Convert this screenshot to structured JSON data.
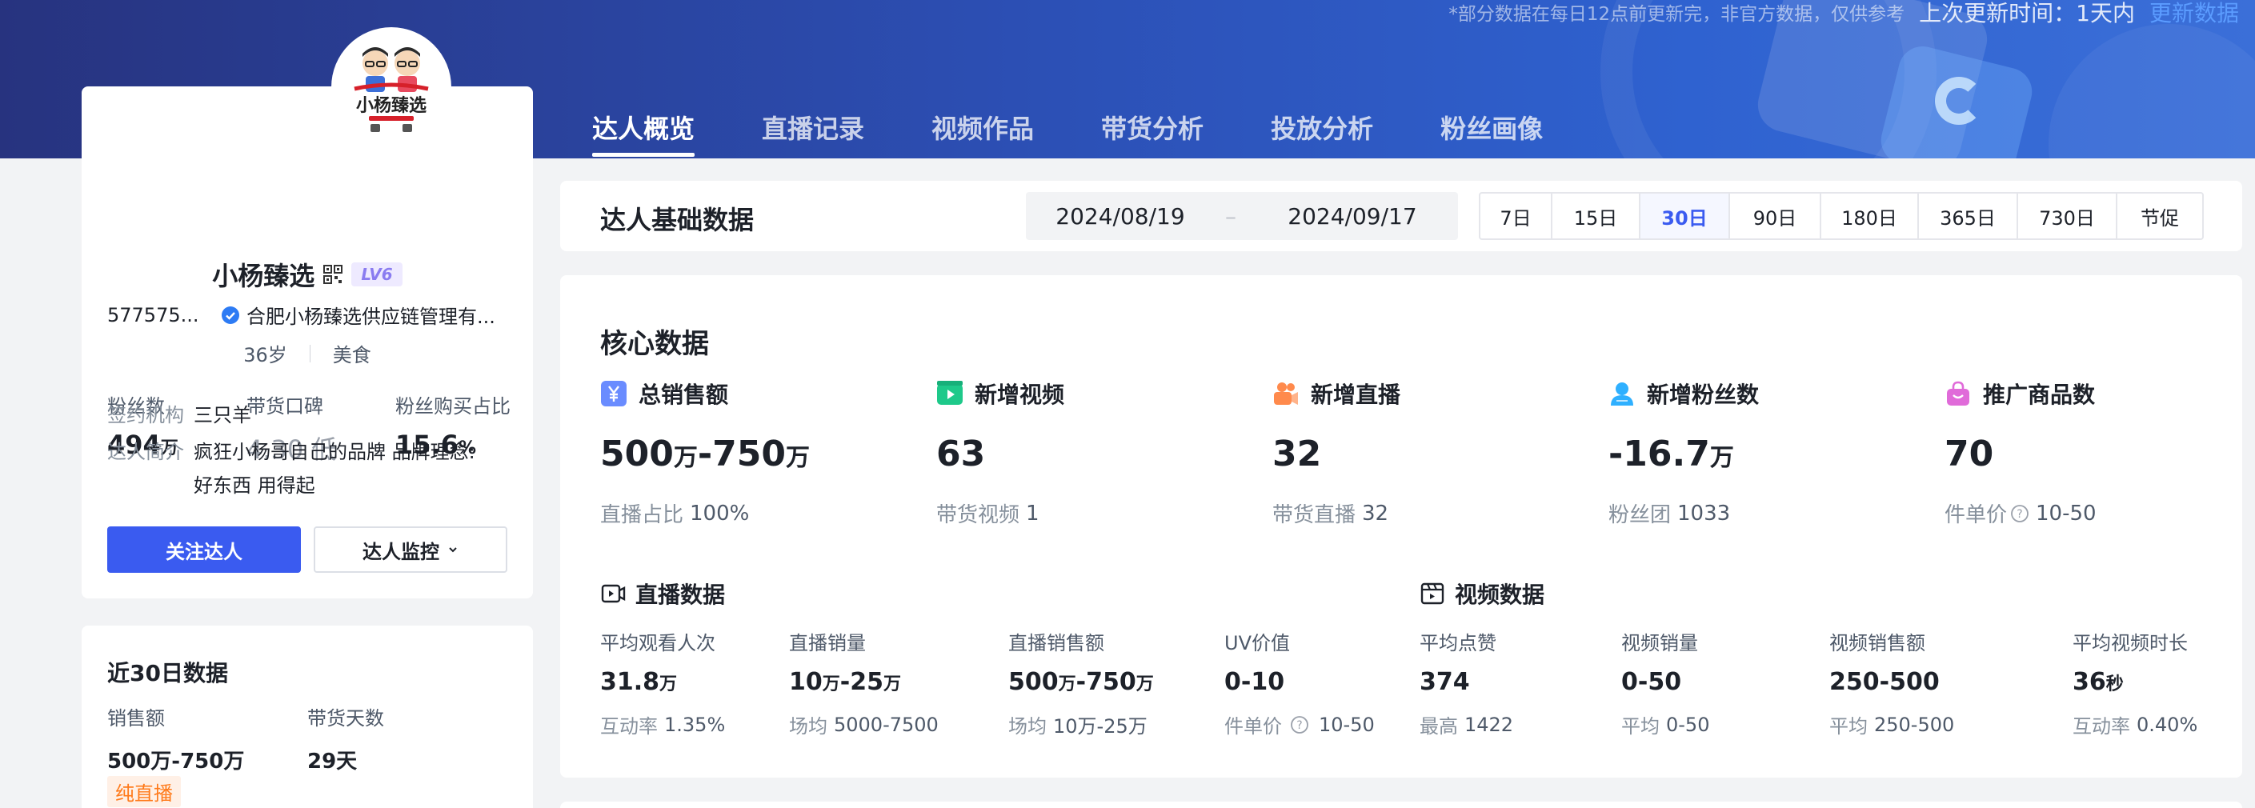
{
  "top_bar": {
    "note": "*部分数据在每日12点前更新完，非官方数据，仅供参考",
    "last_update_label": "上次更新时间：1天内",
    "update_link": "更新数据"
  },
  "profile": {
    "avatar_logo_text": "小杨臻选",
    "name": "小杨臻选",
    "level": "LV6",
    "uid": "577575...",
    "company": "合肥小杨臻选供应链管理有...",
    "age": "36岁",
    "category": "美食",
    "stats": [
      {
        "label": "粉丝数",
        "value": "494",
        "unit": "万"
      },
      {
        "label": "带货口碑",
        "value": "4.30 低"
      },
      {
        "label": "粉丝购买占比",
        "value": "15.6",
        "unit": "%"
      }
    ],
    "agency_label": "签约机构",
    "agency": "三只羊",
    "intro_label": "达人简介",
    "intro_line1": "疯狂小杨哥自己的品牌 品牌理念:",
    "intro_line2": "好东西 用得起",
    "follow_button": "关注达人",
    "monitor_button": "达人监控"
  },
  "recent30": {
    "title": "近30日数据",
    "sales_label": "销售额",
    "sales_value": "500万-750万",
    "days_label": "带货天数",
    "days_value": "29天",
    "tag": "纯直播"
  },
  "tabs": [
    {
      "label": "达人概览",
      "active": true
    },
    {
      "label": "直播记录"
    },
    {
      "label": "视频作品"
    },
    {
      "label": "带货分析"
    },
    {
      "label": "投放分析"
    },
    {
      "label": "粉丝画像"
    }
  ],
  "basic": {
    "title": "达人基础数据",
    "date_start": "2024/08/19",
    "date_sep": "–",
    "date_end": "2024/09/17",
    "ranges": [
      "7日",
      "15日",
      "30日",
      "90日",
      "180日",
      "365日",
      "730日",
      "节促"
    ],
    "active_range": "30日"
  },
  "core": {
    "title": "核心数据",
    "kpis": [
      {
        "label": "总销售额",
        "value_a": "500",
        "unit_a": "万",
        "value_b": "-750",
        "unit_b": "万",
        "sub_label": "直播占比",
        "sub_value": "100%",
        "icon": "yen-icon",
        "color": "#6a8cff"
      },
      {
        "label": "新增视频",
        "value_a": "63",
        "sub_label": "带货视频",
        "sub_value": "1",
        "icon": "video-play-icon",
        "color": "#1ec98a"
      },
      {
        "label": "新增直播",
        "value_a": "32",
        "sub_label": "带货直播",
        "sub_value": "32",
        "icon": "live-camera-icon",
        "color": "#ff8a4c"
      },
      {
        "label": "新增粉丝数",
        "value_a": "-16.7",
        "unit_a": "万",
        "sub_label": "粉丝团",
        "sub_value": "1033",
        "icon": "user-icon",
        "color": "#2fb0ff"
      },
      {
        "label": "推广商品数",
        "value_a": "70",
        "sub_label": "件单价",
        "sub_value": "10-50",
        "icon": "shopping-bag-icon",
        "color": "#e06bd9"
      }
    ],
    "live_section": "直播数据",
    "video_section": "视频数据",
    "live_metrics": [
      {
        "label": "平均观看人次",
        "value": "31.8",
        "unit": "万",
        "sub_label": "互动率",
        "sub_value": "1.35%"
      },
      {
        "label": "直播销量",
        "value": "10",
        "unit": "万",
        "value2": "-25",
        "unit2": "万",
        "sub_label": "场均",
        "sub_value": "5000-7500"
      },
      {
        "label": "直播销售额",
        "value": "500",
        "unit": "万",
        "value2": "-750",
        "unit2": "万",
        "sub_label": "场均",
        "sub_value": "10万-25万"
      },
      {
        "label": "UV价值",
        "value": "0-10",
        "sub_label": "件单价",
        "sub_value": "10-50"
      }
    ],
    "video_metrics": [
      {
        "label": "平均点赞",
        "value": "374",
        "sub_label": "最高",
        "sub_value": "1422"
      },
      {
        "label": "视频销量",
        "value": "0-50",
        "sub_label": "平均",
        "sub_value": "0-50"
      },
      {
        "label": "视频销售额",
        "value": "250-500",
        "sub_label": "平均",
        "sub_value": "250-500"
      },
      {
        "label": "平均视频时长",
        "value": "36",
        "unit": "秒",
        "sub_label": "互动率",
        "sub_value": "0.40%"
      }
    ]
  }
}
